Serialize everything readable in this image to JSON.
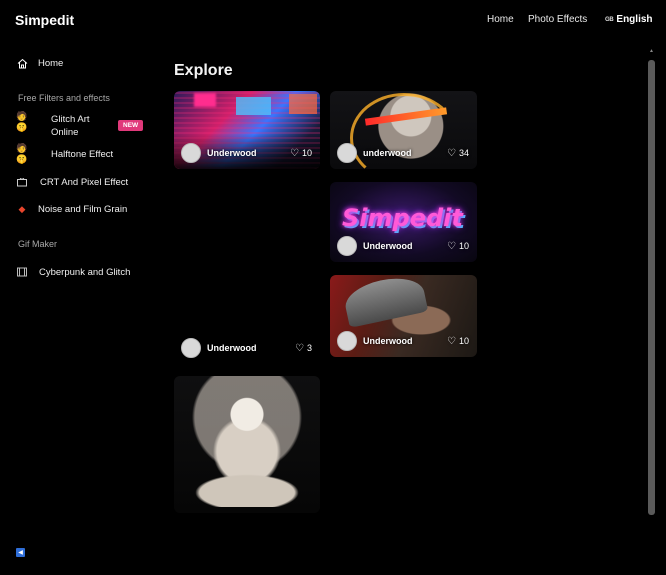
{
  "header": {
    "brand": "Simpedit",
    "nav": {
      "home": "Home",
      "photo_effects": "Photo Effects"
    },
    "language": {
      "flag": "GB",
      "label": "English"
    }
  },
  "sidebar": {
    "home": "Home",
    "section_filters": "Free Filters and effects",
    "items": [
      {
        "label": "Glitch Art\nOnline",
        "badge": "NEW",
        "icon": "emoji-faces-icon"
      },
      {
        "label": "Halftone Effect",
        "icon": "emoji-faces-icon"
      },
      {
        "label": "CRT And Pixel Effect",
        "icon": "tv-icon"
      },
      {
        "label": "Noise and Film Grain",
        "icon": "diamond-icon"
      }
    ],
    "section_gif": "Gif Maker",
    "gif_items": [
      {
        "label": "Cyberpunk and Glitch",
        "icon": "film-icon"
      }
    ]
  },
  "main": {
    "title": "Explore",
    "cards": [
      {
        "author": "Underwood",
        "likes": "10"
      },
      {
        "author": "underwood",
        "likes": "34"
      },
      {
        "author": "Underwood",
        "likes": "10",
        "sign_text": "Simpedit"
      },
      {
        "author": "Underwood",
        "likes": "3"
      },
      {
        "author": "Underwood",
        "likes": "10"
      },
      {
        "author": "",
        "likes": ""
      }
    ]
  },
  "colors": {
    "accent_badge": "#e0397a",
    "background": "#000000"
  }
}
